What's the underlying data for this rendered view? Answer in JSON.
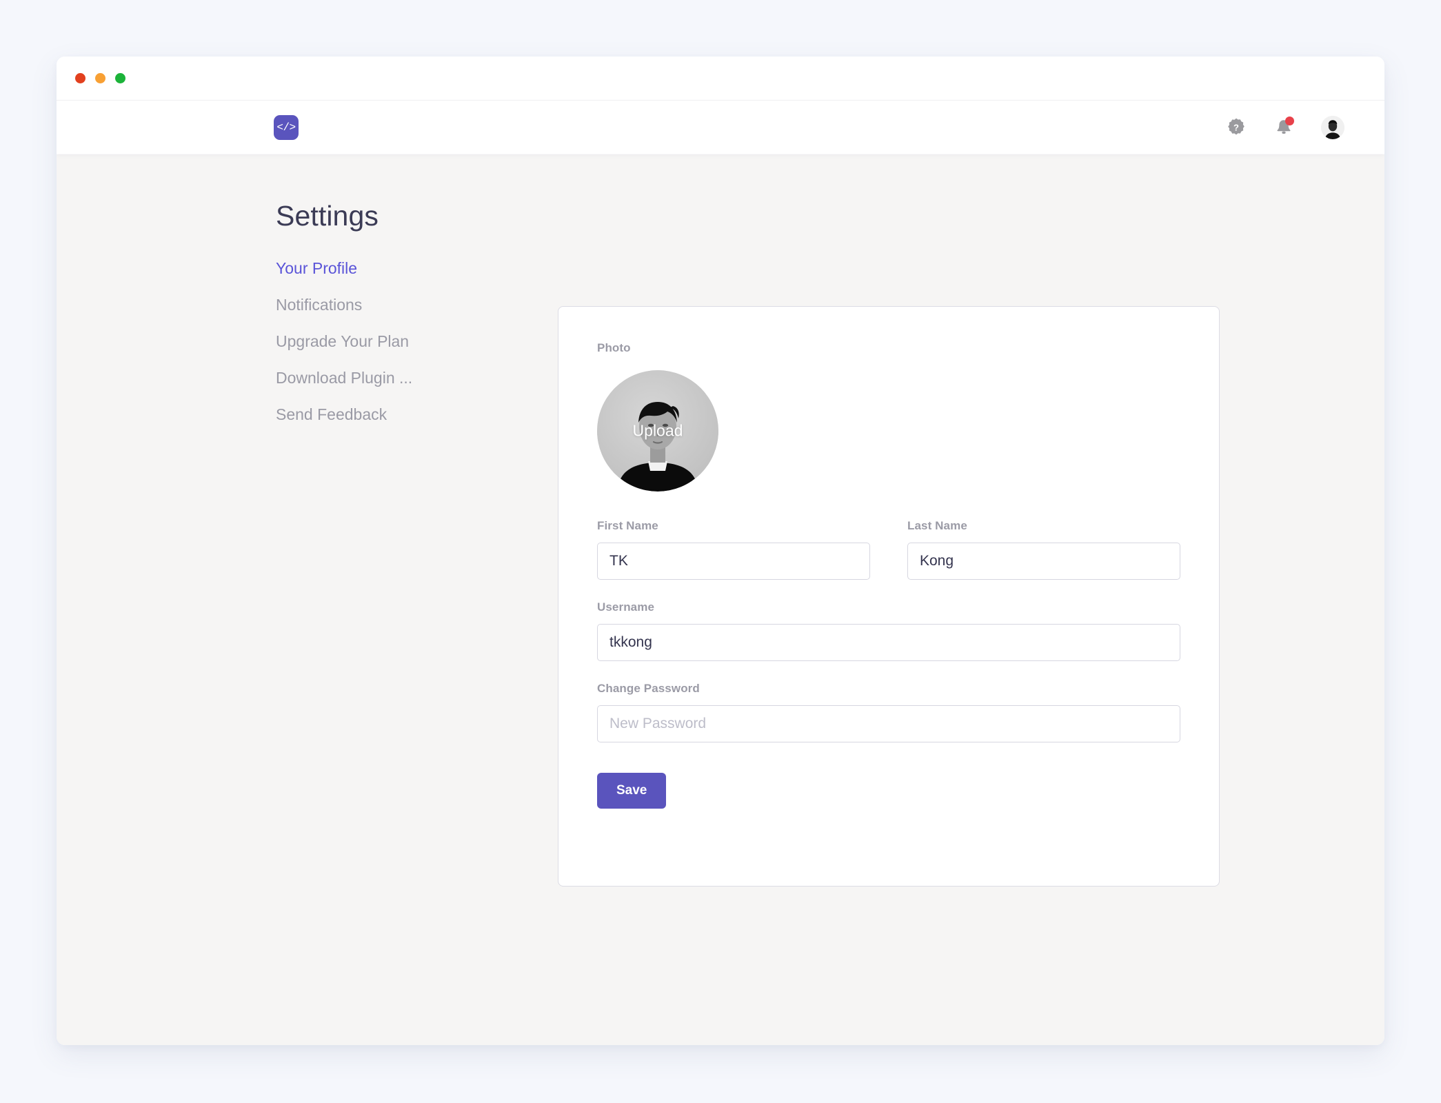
{
  "window": {
    "traffic_lights": [
      {
        "name": "close",
        "color": "#e2401e"
      },
      {
        "name": "minimize",
        "color": "#f8a034"
      },
      {
        "name": "maximize",
        "color": "#1cb339"
      }
    ]
  },
  "navbar": {
    "logo_glyph": "</>",
    "logo_color": "#5a54bd",
    "icons": [
      {
        "name": "help-icon",
        "glyph": "?"
      },
      {
        "name": "notifications-bell-icon",
        "badge_color": "#e8414a"
      },
      {
        "name": "user-avatar"
      }
    ]
  },
  "page": {
    "title": "Settings",
    "background": "#f6f5f4"
  },
  "sidebar": {
    "items": [
      {
        "label": "Your Profile",
        "active": true
      },
      {
        "label": "Notifications",
        "active": false
      },
      {
        "label": "Upgrade Your Plan",
        "active": false
      },
      {
        "label": "Download Plugin ...",
        "active": false
      },
      {
        "label": "Send Feedback",
        "active": false
      }
    ],
    "active_color": "#5a54d8",
    "inactive_color": "#9a9aa5"
  },
  "form": {
    "photo": {
      "label": "Photo",
      "overlay_text": "Upload"
    },
    "first_name": {
      "label": "First Name",
      "value": "TK",
      "placeholder": ""
    },
    "last_name": {
      "label": "Last Name",
      "value": "Kong",
      "placeholder": ""
    },
    "username": {
      "label": "Username",
      "value": "tkkong",
      "placeholder": ""
    },
    "password": {
      "label": "Change Password",
      "value": "",
      "placeholder": "New Password"
    },
    "save_label": "Save",
    "save_color": "#5a54bd"
  }
}
